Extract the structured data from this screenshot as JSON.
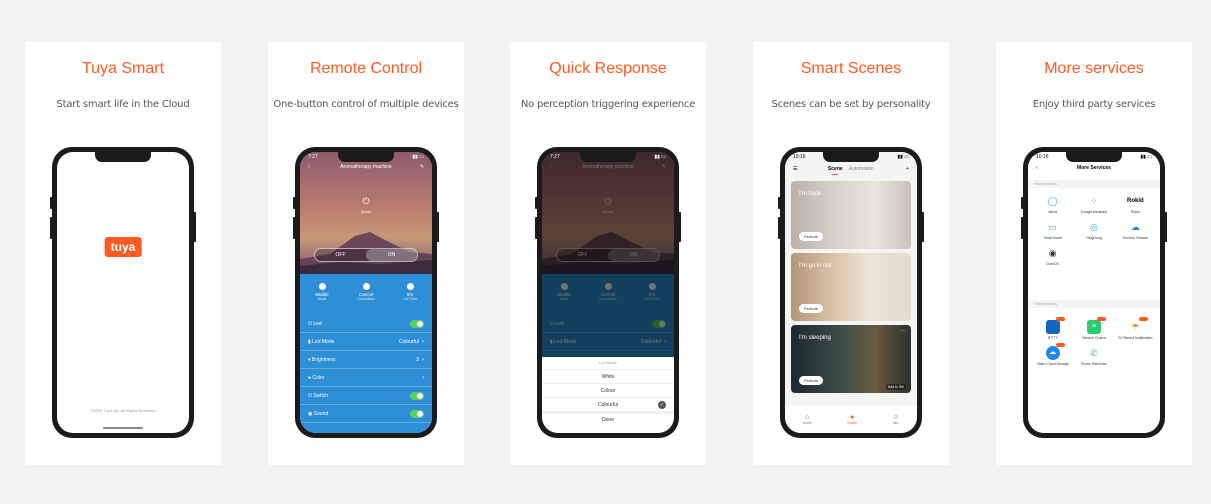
{
  "cards": [
    {
      "title": "Tuya Smart",
      "subtitle": "Start smart life in the Cloud"
    },
    {
      "title": "Remote Control",
      "subtitle": "One-button control of multiple devices"
    },
    {
      "title": "Quick Response",
      "subtitle": "No perception triggering experience"
    },
    {
      "title": "Smart Scenes",
      "subtitle": "Scenes can be set by personality"
    },
    {
      "title": "More services",
      "subtitle": "Enjoy third party services"
    }
  ],
  "splash": {
    "logo": "tuya",
    "copyright": "©2019 Tuya Inc. All Rights Reserved"
  },
  "aroma": {
    "time": "7:27",
    "title": "Aromatherapy machine",
    "power_label": "Spray",
    "off": "OFF",
    "on": "ON",
    "modes": [
      {
        "name": "Middle",
        "sub": "Mode"
      },
      {
        "name": "Cancel",
        "sub": "Countdown"
      },
      {
        "name": "0m",
        "sub": "Left Time"
      }
    ],
    "rows": [
      {
        "label": "Led",
        "value": "",
        "control": "switch"
      },
      {
        "label": "Led Mode",
        "value": "Colourful",
        "control": "chevron"
      },
      {
        "label": "Brightness",
        "value": "3",
        "control": "chevron"
      },
      {
        "label": "Color",
        "value": "",
        "control": "chevron"
      },
      {
        "label": "Switch",
        "value": "",
        "control": "switch"
      },
      {
        "label": "Sound",
        "value": "",
        "control": "switch"
      }
    ],
    "sheet": {
      "header": "Led Mode",
      "options": [
        "White",
        "Colour",
        "Colourful"
      ],
      "selected": "Colourful",
      "done": "Done"
    }
  },
  "scenes": {
    "time": "10:16",
    "tab_scene": "Scene",
    "tab_automation": "Automation",
    "cards": [
      {
        "name": "I'm back",
        "action": "Perform"
      },
      {
        "name": "I'm go in out",
        "action": "Perform"
      },
      {
        "name": "I'm sleeping",
        "action": "Perform",
        "siri": "Add to Siri"
      }
    ],
    "tabbar": [
      {
        "label": "Home",
        "active": false
      },
      {
        "label": "Scene",
        "active": true
      },
      {
        "label": "Me",
        "active": false
      }
    ]
  },
  "services": {
    "time": "10:16",
    "title": "More Services",
    "section1": "Voice Services",
    "section2": "Other Services",
    "voice": [
      {
        "name": "Alexa",
        "icon": "alexa-icon",
        "color": "#29b6f6"
      },
      {
        "name": "Google Assistant",
        "icon": "google-assistant-icon",
        "color": "#4285f4"
      },
      {
        "name": "Rokid",
        "icon": "rokid-icon",
        "color": "#000000"
      },
      {
        "name": "Tmall Genie",
        "icon": "tmall-genie-icon",
        "color": "#5b8def"
      },
      {
        "name": "DingDong",
        "icon": "dingdong-icon",
        "color": "#2196f3"
      },
      {
        "name": "Tencent Xiaowei",
        "icon": "tencent-icon",
        "color": "#1e88e5"
      },
      {
        "name": "DuerOS",
        "icon": "dueros-icon",
        "color": "#333333"
      }
    ],
    "other": [
      {
        "name": "IFTTT",
        "icon": "ifttt-icon",
        "color": "#1565c0",
        "badge": true
      },
      {
        "name": "Service Orders",
        "icon": "service-orders-icon",
        "color": "#2ecc71",
        "badge": true
      },
      {
        "name": "SI Filtered Notification",
        "icon": "notification-icon",
        "color": "#ff8a00",
        "badge": true
      },
      {
        "name": "Video Cloud Storage",
        "icon": "cloud-storage-icon",
        "color": "#1e88e5",
        "badge": true
      },
      {
        "name": "Phone Reminder",
        "icon": "phone-icon",
        "color": "#2ecc71",
        "badge": false
      }
    ]
  }
}
